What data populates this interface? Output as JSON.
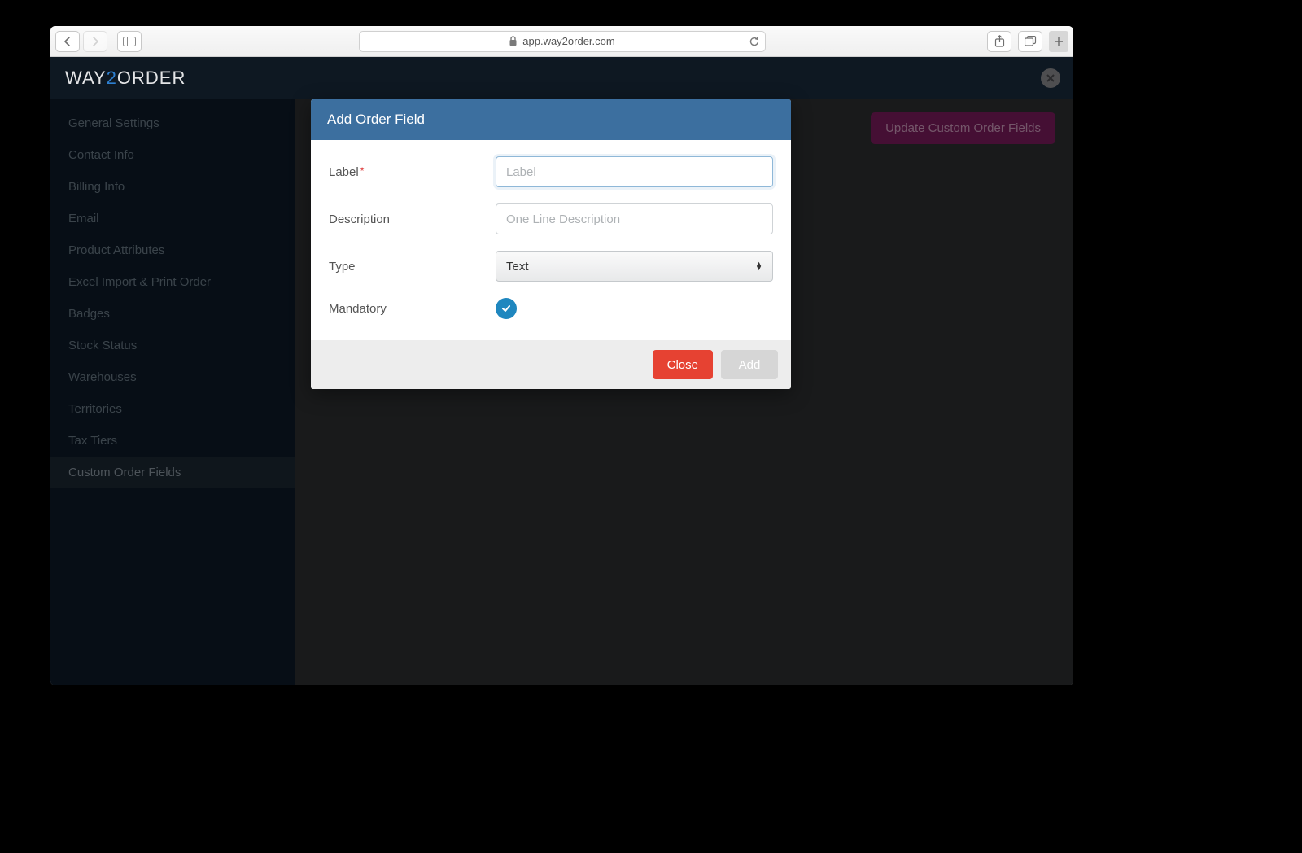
{
  "browser": {
    "url": "app.way2order.com"
  },
  "header": {
    "logo_way": "WAY",
    "logo_2": "2",
    "logo_order": "ORDER"
  },
  "sidebar": {
    "items": [
      {
        "label": "General Settings"
      },
      {
        "label": "Contact Info"
      },
      {
        "label": "Billing Info"
      },
      {
        "label": "Email"
      },
      {
        "label": "Product Attributes"
      },
      {
        "label": "Excel Import & Print Order"
      },
      {
        "label": "Badges"
      },
      {
        "label": "Stock Status"
      },
      {
        "label": "Warehouses"
      },
      {
        "label": "Territories"
      },
      {
        "label": "Tax Tiers"
      },
      {
        "label": "Custom Order Fields"
      }
    ],
    "active_index": 11
  },
  "content": {
    "update_button": "Update Custom Order Fields"
  },
  "modal": {
    "title": "Add Order Field",
    "fields": {
      "label_label": "Label",
      "label_placeholder": "Label",
      "description_label": "Description",
      "description_placeholder": "One Line Description",
      "type_label": "Type",
      "type_value": "Text",
      "mandatory_label": "Mandatory"
    },
    "footer": {
      "close": "Close",
      "add": "Add"
    }
  }
}
